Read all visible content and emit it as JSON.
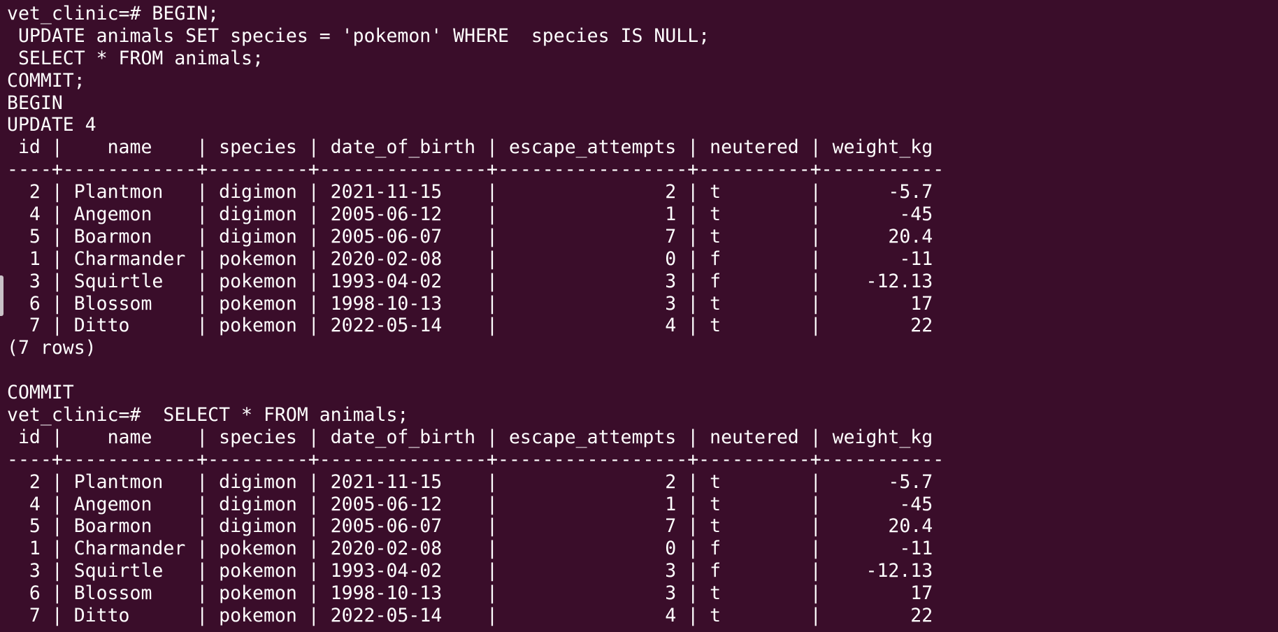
{
  "terminal": {
    "lines": [
      "vet_clinic=# BEGIN;",
      " UPDATE animals SET species = 'pokemon' WHERE  species IS NULL;",
      " SELECT * FROM animals;",
      "COMMIT;",
      "BEGIN",
      "UPDATE 4",
      " id |    name    | species | date_of_birth | escape_attempts | neutered | weight_kg",
      "----+------------+---------+---------------+-----------------+----------+-----------",
      "  2 | Plantmon   | digimon | 2021-11-15    |               2 | t        |      -5.7",
      "  4 | Angemon    | digimon | 2005-06-12    |               1 | t        |       -45",
      "  5 | Boarmon    | digimon | 2005-06-07    |               7 | t        |      20.4",
      "  1 | Charmander | pokemon | 2020-02-08    |               0 | f        |       -11",
      "  3 | Squirtle   | pokemon | 1993-04-02    |               3 | f        |    -12.13",
      "  6 | Blossom    | pokemon | 1998-10-13    |               3 | t        |        17",
      "  7 | Ditto      | pokemon | 2022-05-14    |               4 | t        |        22",
      "(7 rows)",
      "",
      "COMMIT",
      "vet_clinic=#  SELECT * FROM animals;",
      " id |    name    | species | date_of_birth | escape_attempts | neutered | weight_kg",
      "----+------------+---------+---------------+-----------------+----------+-----------",
      "  2 | Plantmon   | digimon | 2021-11-15    |               2 | t        |      -5.7",
      "  4 | Angemon    | digimon | 2005-06-12    |               1 | t        |       -45",
      "  5 | Boarmon    | digimon | 2005-06-07    |               7 | t        |      20.4",
      "  1 | Charmander | pokemon | 2020-02-08    |               0 | f        |       -11",
      "  3 | Squirtle   | pokemon | 1993-04-02    |               3 | f        |    -12.13",
      "  6 | Blossom    | pokemon | 1998-10-13    |               3 | t        |        17",
      "  7 | Ditto      | pokemon | 2022-05-14    |               4 | t        |        22"
    ]
  }
}
